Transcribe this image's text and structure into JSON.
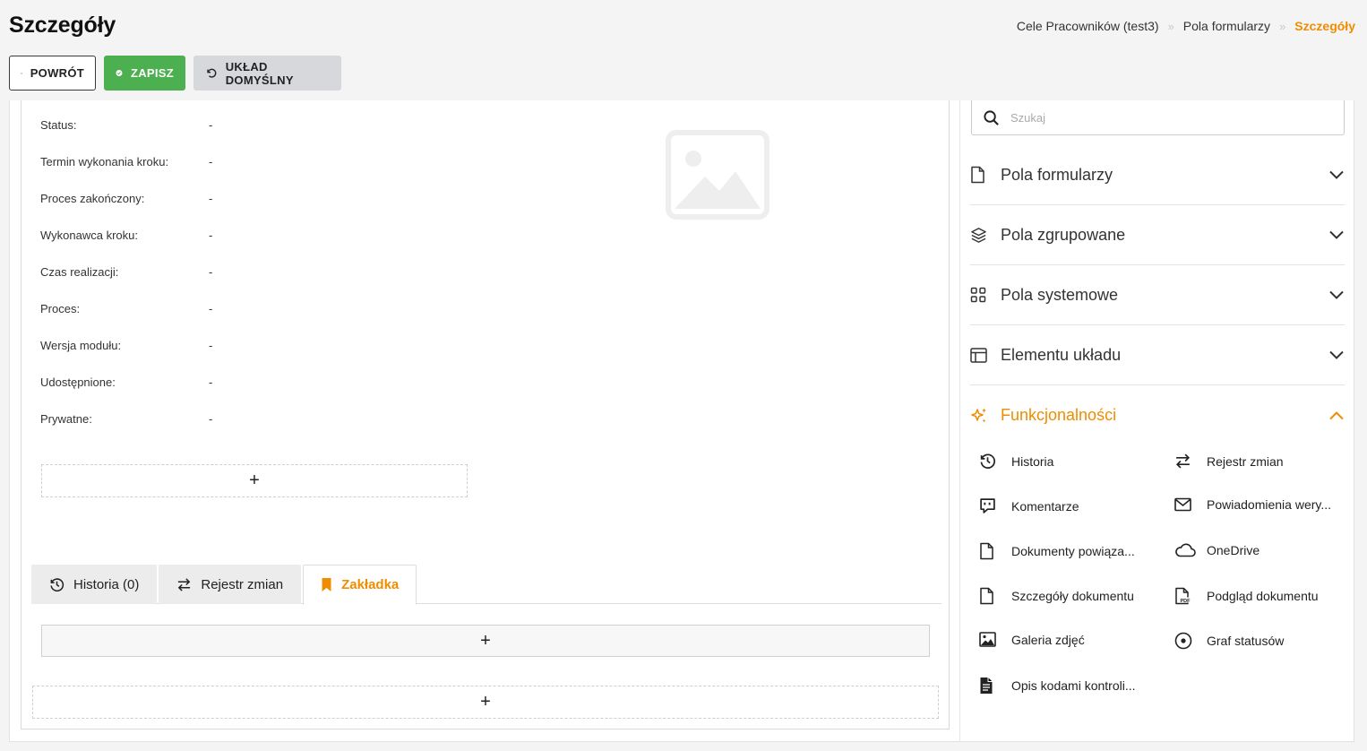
{
  "header": {
    "title": "Szczegóły",
    "breadcrumb": [
      "Cele Pracowników (test3)",
      "Pola formularzy",
      "Szczegóły"
    ]
  },
  "toolbar": {
    "back_label": "POWRÓT",
    "save_label": "ZAPISZ",
    "default_layout_label": "UKŁAD DOMYŚLNY"
  },
  "fields": [
    {
      "label": "Status:",
      "value": "-"
    },
    {
      "label": "Termin wykonania kroku:",
      "value": "-"
    },
    {
      "label": "Proces zakończony:",
      "value": "-"
    },
    {
      "label": "Wykonawca kroku:",
      "value": "-"
    },
    {
      "label": "Czas realizacji:",
      "value": "-"
    },
    {
      "label": "Proces:",
      "value": "-"
    },
    {
      "label": "Wersja modułu:",
      "value": "-"
    },
    {
      "label": "Udostępnione:",
      "value": "-"
    },
    {
      "label": "Prywatne:",
      "value": "-"
    }
  ],
  "add_symbol": "+",
  "tabs": [
    {
      "label": "Historia (0)",
      "icon": "history-icon"
    },
    {
      "label": "Rejestr zmian",
      "icon": "swap-icon"
    },
    {
      "label": "Zakładka",
      "icon": "bookmark-icon"
    }
  ],
  "sidebar": {
    "search_placeholder": "Szukaj",
    "sections": [
      {
        "label": "Pola formularzy",
        "icon": "file-icon",
        "open": false
      },
      {
        "label": "Pola zgrupowane",
        "icon": "layers-icon",
        "open": false
      },
      {
        "label": "Pola systemowe",
        "icon": "grid-icon",
        "open": false
      },
      {
        "label": "Elementu układu",
        "icon": "layout-icon",
        "open": false
      },
      {
        "label": "Funkcjonalności",
        "icon": "sparkles-icon",
        "open": true
      }
    ],
    "features": [
      {
        "label": "Historia",
        "icon": "history-icon"
      },
      {
        "label": "Rejestr zmian",
        "icon": "swap-icon"
      },
      {
        "label": "Komentarze",
        "icon": "comment-icon"
      },
      {
        "label": "Powiadomienia wery...",
        "icon": "mail-icon"
      },
      {
        "label": "Dokumenty powiąza...",
        "icon": "file-icon"
      },
      {
        "label": "OneDrive",
        "icon": "cloud-icon"
      },
      {
        "label": "Szczegóły dokumentu",
        "icon": "file-icon"
      },
      {
        "label": "Podgląd dokumentu",
        "icon": "pdf-icon"
      },
      {
        "label": "Galeria zdjęć",
        "icon": "image-icon"
      },
      {
        "label": "Graf statusów",
        "icon": "target-icon"
      },
      {
        "label": "Opis kodami kontroli...",
        "icon": "document-text-icon"
      }
    ]
  },
  "colors": {
    "accent": "#f08c00",
    "save": "#4caf50",
    "default_button": "#d6d8db"
  }
}
